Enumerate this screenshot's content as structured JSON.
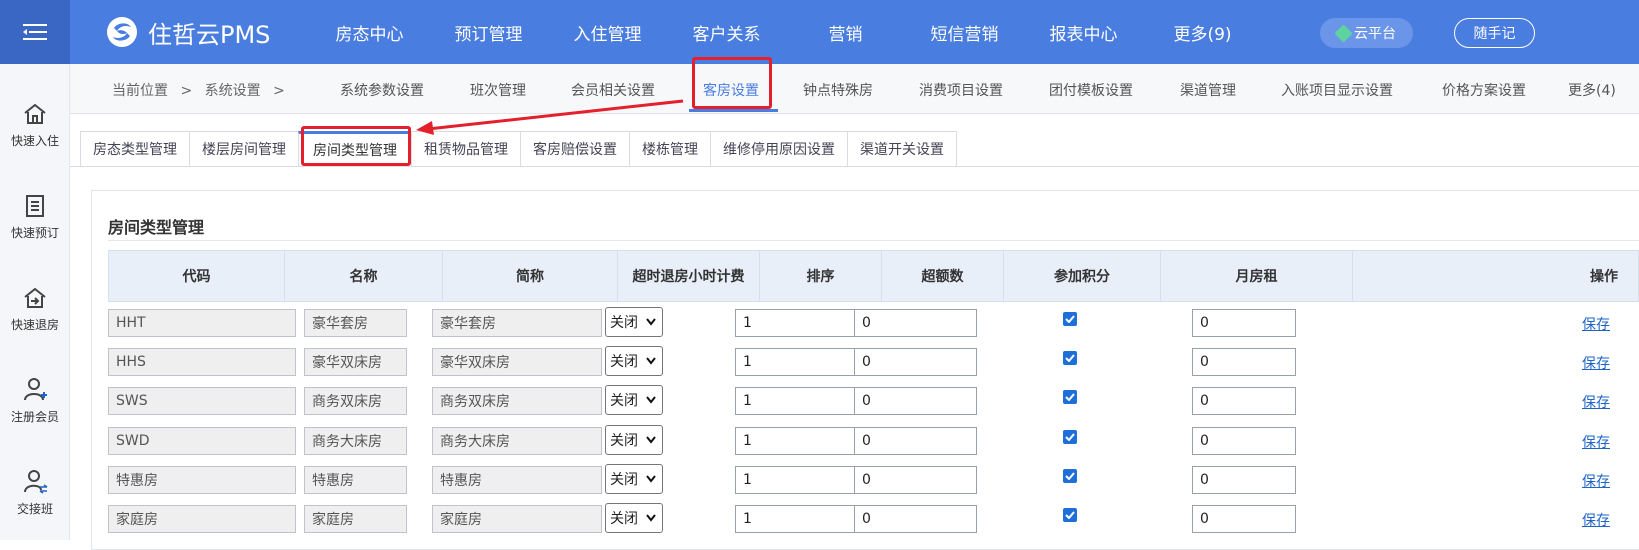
{
  "app": {
    "logo_text": "住哲云PMS"
  },
  "topnav": [
    "房态中心",
    "预订管理",
    "入住管理",
    "客户关系",
    "营销",
    "短信营销",
    "报表中心",
    "更多(9)"
  ],
  "top_buttons": {
    "cloud": "云平台",
    "memo": "随手记"
  },
  "sidebar": [
    {
      "label": "快速入住",
      "icon": "home-icon"
    },
    {
      "label": "快速预订",
      "icon": "document-icon"
    },
    {
      "label": "快速退房",
      "icon": "checkout-icon"
    },
    {
      "label": "注册会员",
      "icon": "user-add-icon"
    },
    {
      "label": "交接班",
      "icon": "user-swap-icon"
    }
  ],
  "breadcrumb": {
    "current": "当前位置",
    "sep": ">",
    "section": "系统设置",
    "sep2": ">"
  },
  "subtabs": [
    "系统参数设置",
    "班次管理",
    "会员相关设置",
    "客房设置",
    "钟点特殊房",
    "消费项目设置",
    "团付模板设置",
    "渠道管理",
    "入账项目显示设置",
    "价格方案设置",
    "更多(4)"
  ],
  "tabs": [
    "房态类型管理",
    "楼层房间管理",
    "房间类型管理",
    "租赁物品管理",
    "客房赔偿设置",
    "楼栋管理",
    "维修停用原因设置",
    "渠道开关设置"
  ],
  "panel": {
    "title": "房间类型管理"
  },
  "table": {
    "headers": [
      "代码",
      "名称",
      "简称",
      "超时退房小时计费",
      "排序",
      "超额数",
      "参加积分",
      "月房租",
      "操作"
    ],
    "rows": [
      {
        "code": "HHT",
        "name": "豪华套房",
        "short": "豪华套房",
        "overtime": "关闭",
        "order": "1",
        "excess": "0",
        "points": true,
        "rent": "0",
        "action": "保存"
      },
      {
        "code": "HHS",
        "name": "豪华双床房",
        "short": "豪华双床房",
        "overtime": "关闭",
        "order": "1",
        "excess": "0",
        "points": true,
        "rent": "0",
        "action": "保存"
      },
      {
        "code": "SWS",
        "name": "商务双床房",
        "short": "商务双床房",
        "overtime": "关闭",
        "order": "1",
        "excess": "0",
        "points": true,
        "rent": "0",
        "action": "保存"
      },
      {
        "code": "SWD",
        "name": "商务大床房",
        "short": "商务大床房",
        "overtime": "关闭",
        "order": "1",
        "excess": "0",
        "points": true,
        "rent": "0",
        "action": "保存"
      },
      {
        "code": "特惠房",
        "name": "特惠房",
        "short": "特惠房",
        "overtime": "关闭",
        "order": "1",
        "excess": "0",
        "points": true,
        "rent": "0",
        "action": "保存"
      },
      {
        "code": "家庭房",
        "name": "家庭房",
        "short": "家庭房",
        "overtime": "关闭",
        "order": "1",
        "excess": "0",
        "points": true,
        "rent": "0",
        "action": "保存"
      }
    ]
  },
  "colors": {
    "primary": "#4a7de0",
    "highlight": "#e3202c",
    "link": "#1e63c8"
  }
}
